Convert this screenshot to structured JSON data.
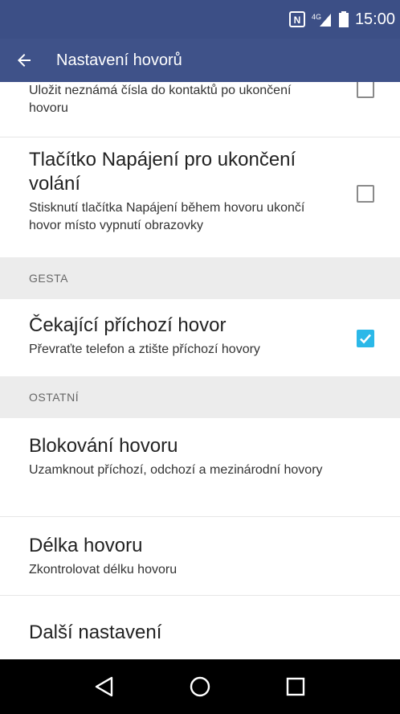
{
  "status_bar": {
    "time": "15:00",
    "icons": [
      "nfc-icon",
      "signal-icon",
      "battery-icon"
    ]
  },
  "app_bar": {
    "title": "Nastavení hovorů",
    "back_icon": "arrow-back-icon"
  },
  "settings": {
    "save_unknown": {
      "subtitle": "Uložit neznámá čísla do kontaktů po ukončení hovoru",
      "checked": false
    },
    "power_button": {
      "title": "Tlačítko Napájení pro ukončení volání",
      "subtitle": "Stisknutí tlačítka Napájení během hovoru ukončí hovor místo vypnutí obrazovky",
      "checked": false
    },
    "section_gestures": "GESTA",
    "call_waiting": {
      "title": "Čekající příchozí hovor",
      "subtitle": "Převraťte telefon a ztište příchozí hovory",
      "checked": true
    },
    "section_other": "OSTATNÍ",
    "call_blocking": {
      "title": "Blokování hovoru",
      "subtitle": "Uzamknout příchozí, odchozí a mezinárodní hovory"
    },
    "call_duration": {
      "title": "Délka hovoru",
      "subtitle": "Zkontrolovat délku hovoru"
    },
    "more_settings": {
      "title": "Další nastavení"
    }
  },
  "nav_bar": {
    "buttons": [
      "back-triangle-icon",
      "home-circle-icon",
      "recents-square-icon"
    ]
  },
  "colors": {
    "status_bar": "#3c4f86",
    "app_bar": "#3f5289",
    "checkbox_checked": "#2bb8e8",
    "section_bg": "#ececec"
  }
}
